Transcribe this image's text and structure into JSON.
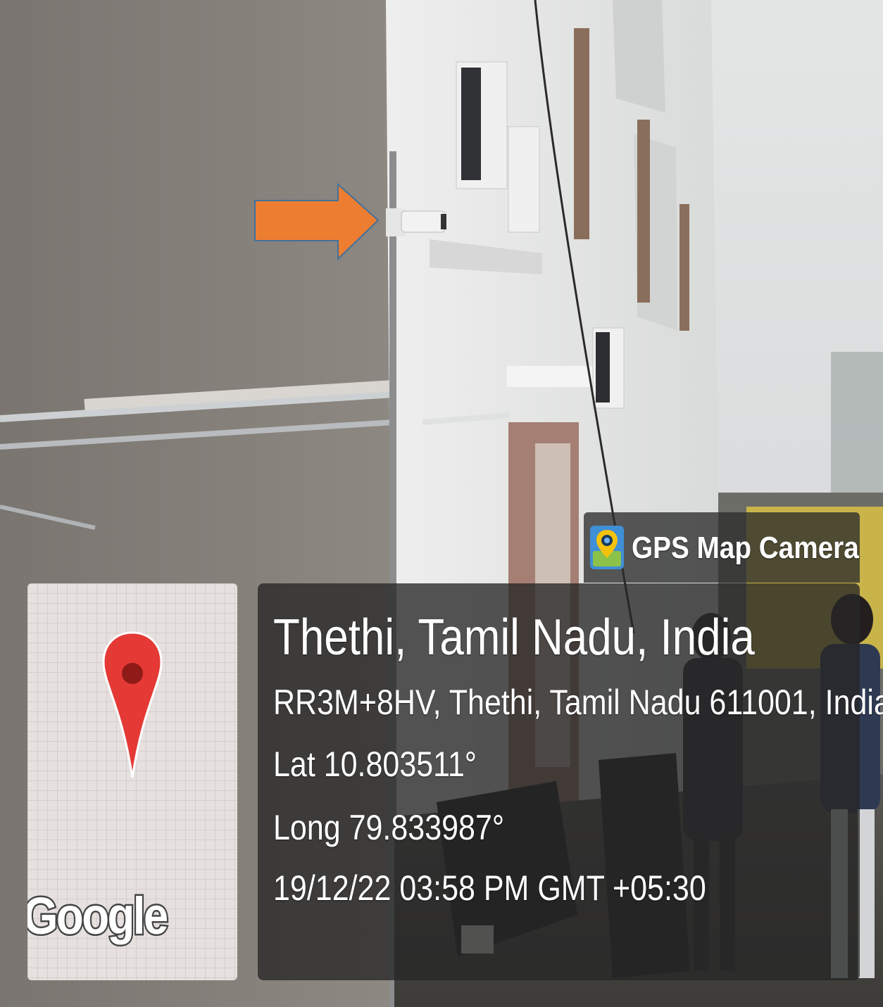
{
  "badge": {
    "app_name": "GPS Map Camera",
    "icon": "gps-map-camera-app-icon"
  },
  "map": {
    "provider_logo": "Google",
    "pin_icon": "map-pin-icon",
    "pin_color": "#e53935"
  },
  "location": {
    "place": "Thethi, Tamil Nadu, India",
    "address": "RR3M+8HV, Thethi, Tamil Nadu 611001, India",
    "latitude": "Lat 10.803511°",
    "longitude": "Long 79.833987°",
    "datetime": "19/12/22 03:58 PM GMT +05:30"
  },
  "annotation": {
    "arrow_icon": "orange-arrow-icon",
    "arrow_color": "#ed7d31",
    "arrow_outline": "#41719c"
  }
}
